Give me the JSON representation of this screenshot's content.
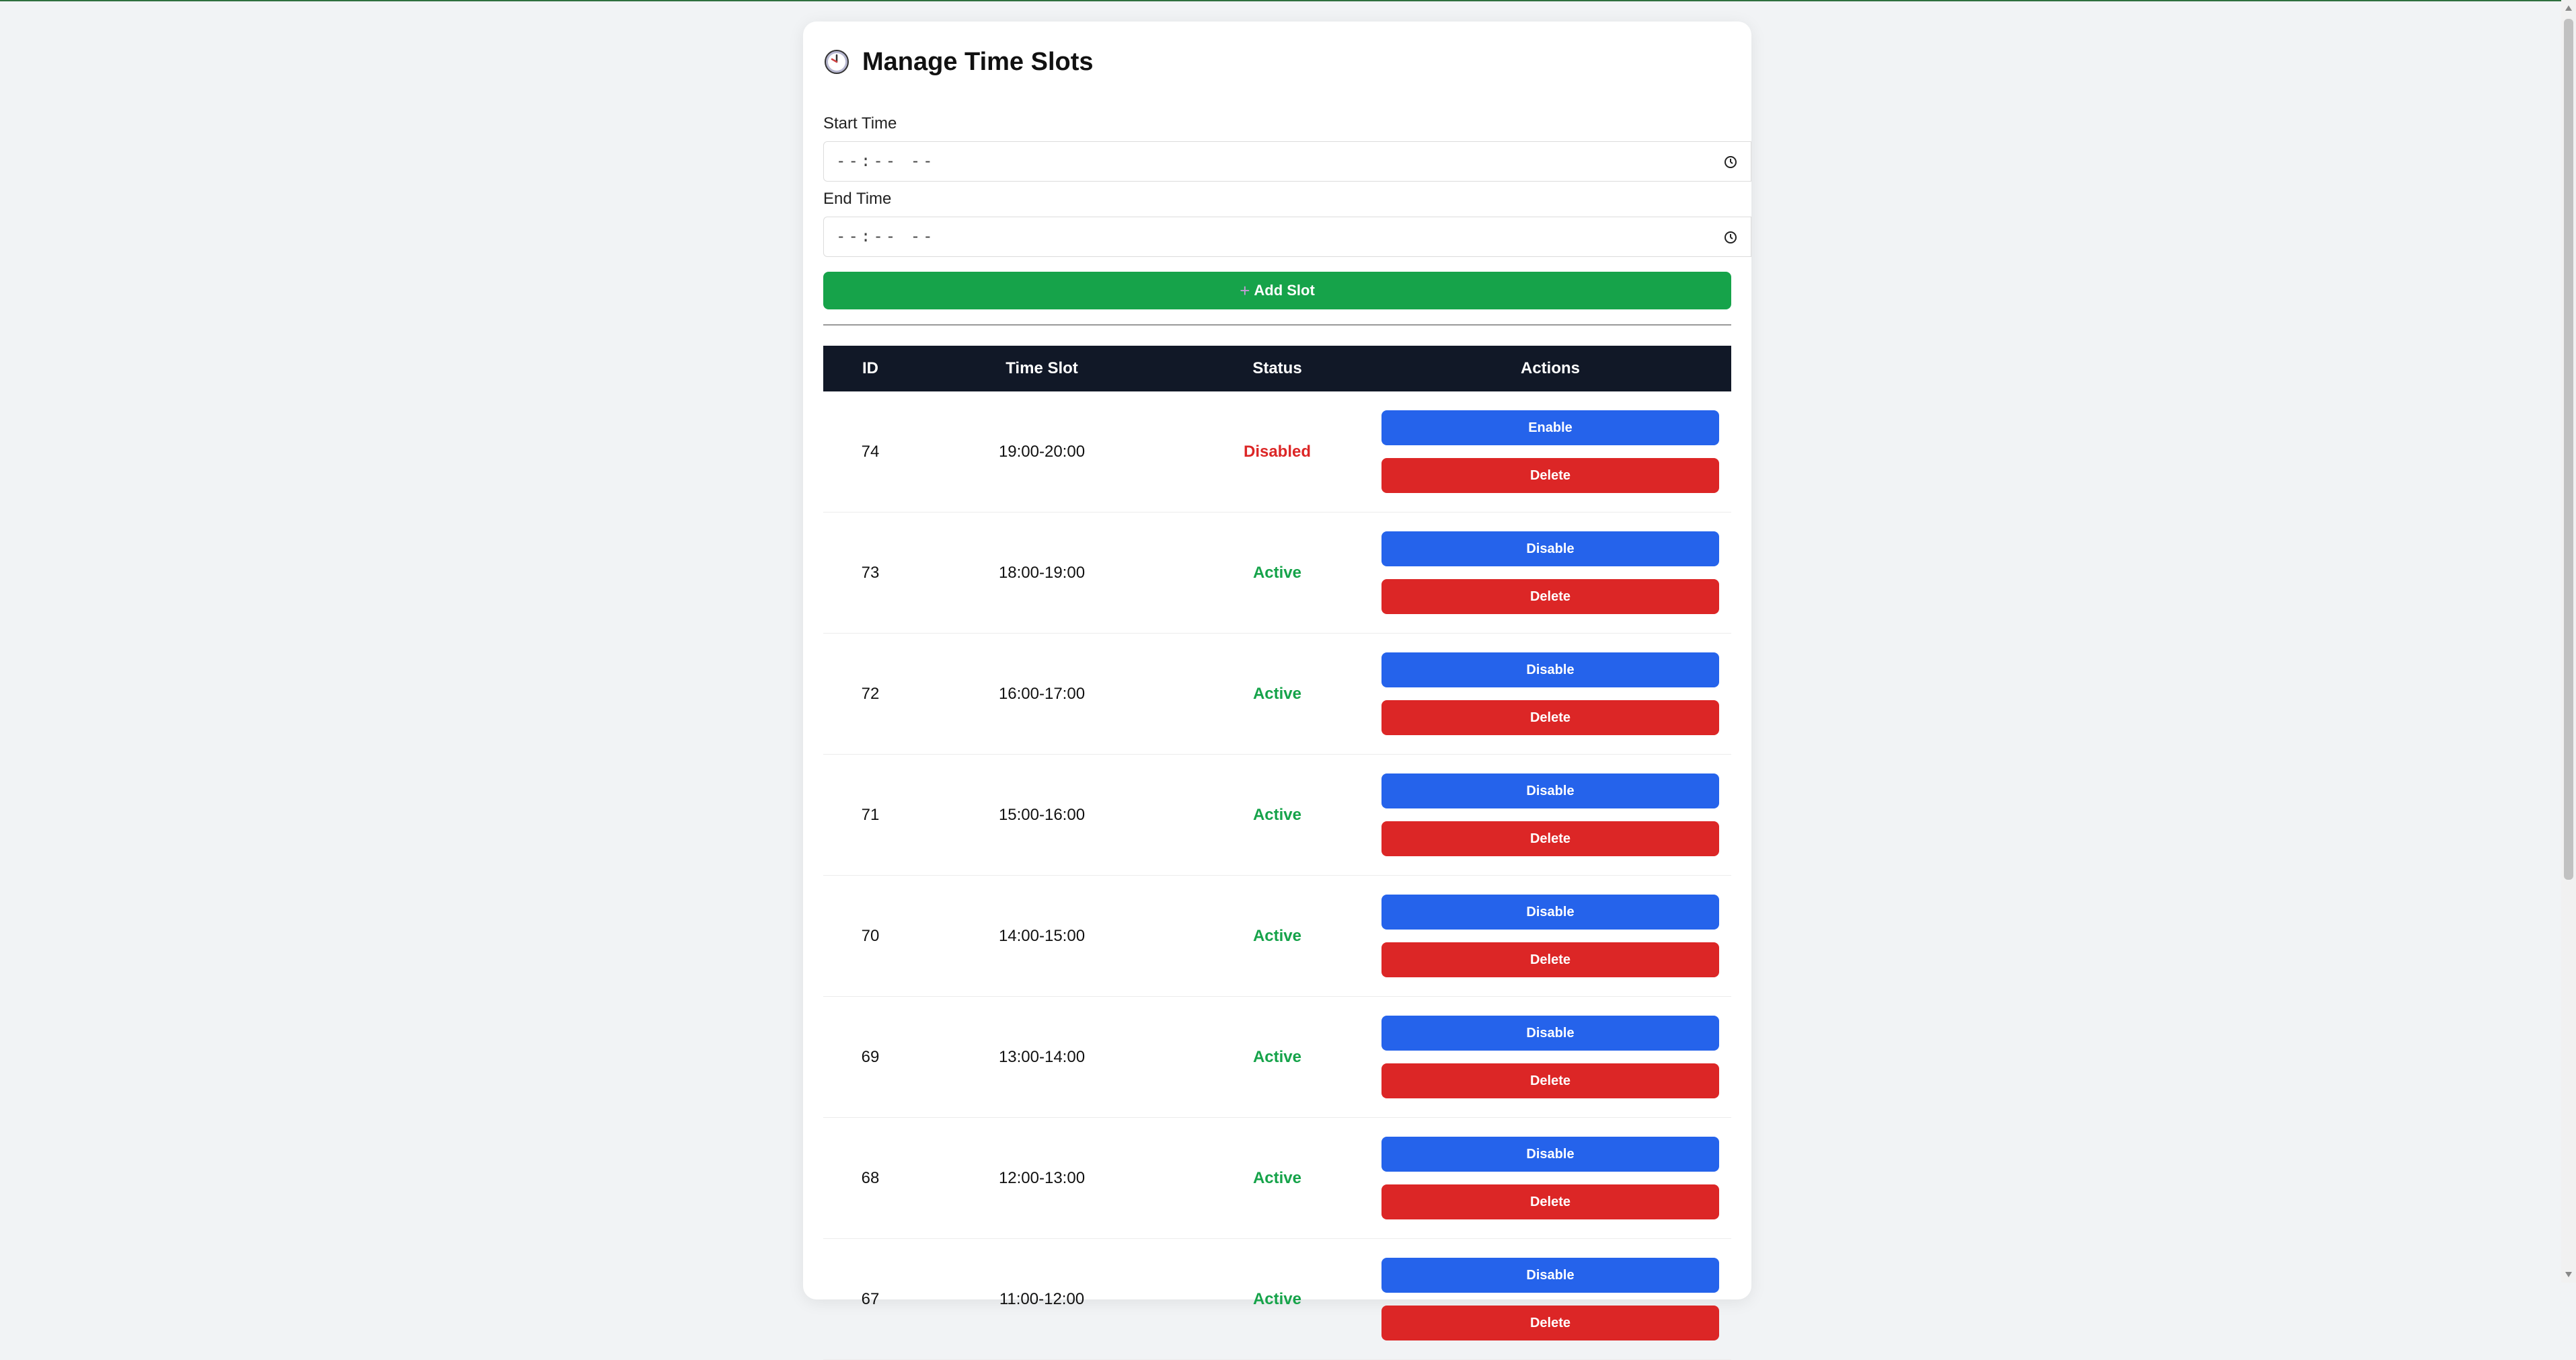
{
  "header": {
    "title": "Manage Time Slots",
    "icon": "clock-icon"
  },
  "form": {
    "start_label": "Start Time",
    "start_value": "--:-- --",
    "end_label": "End Time",
    "end_value": "--:-- --",
    "add_button_icon": "+",
    "add_button_label": "Add Slot"
  },
  "table": {
    "columns": [
      "ID",
      "Time Slot",
      "Status",
      "Actions"
    ],
    "rows": [
      {
        "id": "74",
        "slot": "19:00-20:00",
        "status": "Disabled",
        "toggle": "Enable",
        "delete": "Delete"
      },
      {
        "id": "73",
        "slot": "18:00-19:00",
        "status": "Active",
        "toggle": "Disable",
        "delete": "Delete"
      },
      {
        "id": "72",
        "slot": "16:00-17:00",
        "status": "Active",
        "toggle": "Disable",
        "delete": "Delete"
      },
      {
        "id": "71",
        "slot": "15:00-16:00",
        "status": "Active",
        "toggle": "Disable",
        "delete": "Delete"
      },
      {
        "id": "70",
        "slot": "14:00-15:00",
        "status": "Active",
        "toggle": "Disable",
        "delete": "Delete"
      },
      {
        "id": "69",
        "slot": "13:00-14:00",
        "status": "Active",
        "toggle": "Disable",
        "delete": "Delete"
      },
      {
        "id": "68",
        "slot": "12:00-13:00",
        "status": "Active",
        "toggle": "Disable",
        "delete": "Delete"
      },
      {
        "id": "67",
        "slot": "11:00-12:00",
        "status": "Active",
        "toggle": "Disable",
        "delete": "Delete"
      }
    ]
  },
  "colors": {
    "add": "#16a34a",
    "toggle": "#2563eb",
    "delete": "#dc2626",
    "header_bg": "#111827",
    "active": "#16a34a",
    "disabled": "#dc2626"
  }
}
